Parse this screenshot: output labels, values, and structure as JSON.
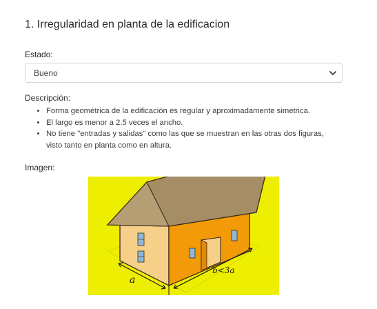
{
  "section": {
    "title": "1. Irregularidad en planta de la edificacion"
  },
  "estado": {
    "label": "Estado:",
    "selected": "Bueno"
  },
  "descripcion": {
    "label": "Descripción:",
    "items": [
      "Forma geométrica de la edificación es regular y aproximadamente simetrica.",
      "El largo es menor a 2.5 veces el ancho.",
      "No tiene \"entradas y salidas\" como las que se muestran en las otras dos figuras, visto tanto en planta como en altura."
    ]
  },
  "imagen": {
    "label": "Imagen:",
    "dim_a": "a",
    "dim_b": "b<3a",
    "background_color": "#eeee00"
  },
  "icons": {
    "select_arrow": "chevron-down-icon"
  }
}
